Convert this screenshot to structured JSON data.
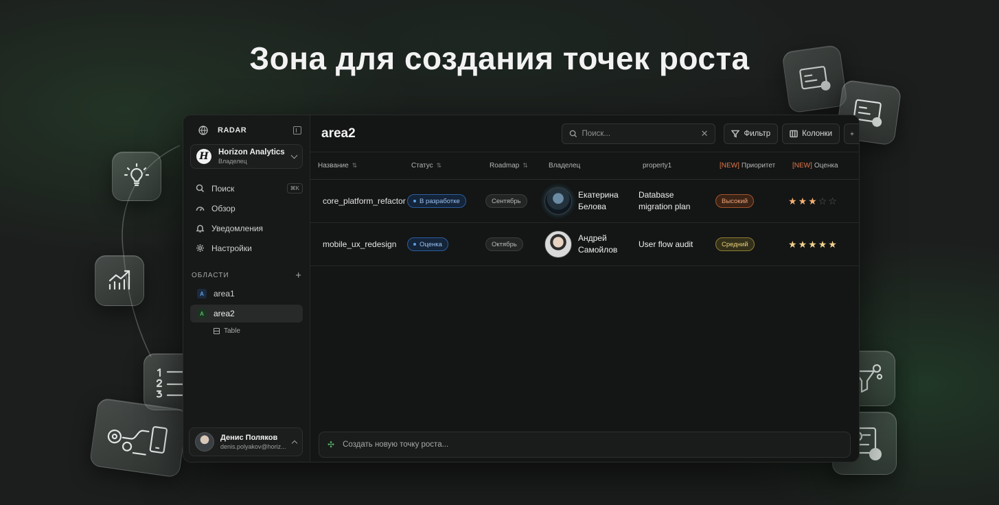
{
  "headline": "Зона для создания точек роста",
  "sidebar": {
    "brand": "RADAR",
    "workspace": {
      "name": "Horizon Analytics",
      "role": "Владелец",
      "logo_letter": "H"
    },
    "nav": [
      {
        "label": "Поиск",
        "icon": "search-icon",
        "shortcut": "⌘K"
      },
      {
        "label": "Обзор",
        "icon": "gauge-icon"
      },
      {
        "label": "Уведомления",
        "icon": "bell-icon"
      },
      {
        "label": "Настройки",
        "icon": "gear-icon"
      }
    ],
    "areas_title": "ОБЛАСТИ",
    "areas": [
      {
        "label": "area1",
        "badge": "A",
        "badge_color": "#5d9de6"
      },
      {
        "label": "area2",
        "badge": "A",
        "badge_color": "#58b36a",
        "active": true
      }
    ],
    "sub_item": "Table",
    "user": {
      "name": "Денис Поляков",
      "email": "denis.polyakov@horiz..."
    }
  },
  "main": {
    "title": "area2",
    "search_placeholder": "Поиск...",
    "filter_label": "Фильтр",
    "columns_label": "Колонки",
    "headers": {
      "name": "Название",
      "status": "Статус",
      "roadmap": "Roadmap",
      "owner": "Владелец",
      "property": "property1",
      "priority_new": "[NEW]",
      "priority": "Приоритет",
      "rating_new": "[NEW]",
      "rating": "Оценка"
    },
    "rows": [
      {
        "name": "core_platform_refactor",
        "status": "В разработке",
        "roadmap": "Сентябрь",
        "owner_first": "Екатерина",
        "owner_last": "Белова",
        "property_line1": "Database",
        "property_line2": "migration plan",
        "priority": "Высокий",
        "rating": 3
      },
      {
        "name": "mobile_ux_redesign",
        "status": "Оценка",
        "roadmap": "Октябрь",
        "owner_first": "Андрей",
        "owner_last": "Самойлов",
        "property_line1": "User flow audit",
        "property_line2": "",
        "priority": "Средний",
        "rating": 5
      }
    ],
    "composer_placeholder": "Создать новую точку роста..."
  },
  "colors": {
    "accent_green": "#58b36a",
    "status_blue": "#5d9de6",
    "priority_high": "#f0a276",
    "priority_medium": "#e8d27a",
    "star": "#f2b074",
    "new_tag": "#e0774a"
  }
}
